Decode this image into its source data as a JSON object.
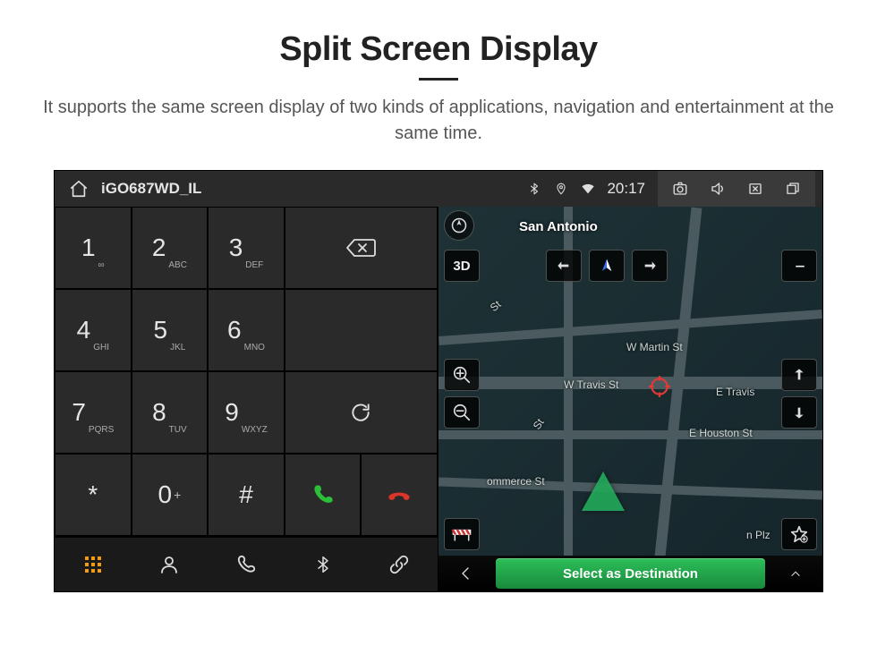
{
  "marketing": {
    "title": "Split Screen Display",
    "subtitle": "It supports the same screen display of two kinds of applications, navigation and entertainment at the same time."
  },
  "statusbar": {
    "app_title": "iGO687WD_IL",
    "time": "20:17",
    "icons": {
      "home": "home-icon",
      "bluetooth": "bluetooth-icon",
      "location": "location-pin-icon",
      "wifi": "wifi-icon",
      "camera": "camera-icon",
      "volume": "volume-icon",
      "close": "close-app-icon",
      "recent": "recent-apps-icon"
    }
  },
  "dialer": {
    "keys": [
      {
        "num": "1",
        "letters": "∞"
      },
      {
        "num": "2",
        "letters": "ABC"
      },
      {
        "num": "3",
        "letters": "DEF"
      },
      {
        "num": "4",
        "letters": "GHI"
      },
      {
        "num": "5",
        "letters": "JKL"
      },
      {
        "num": "6",
        "letters": "MNO"
      },
      {
        "num": "7",
        "letters": "PQRS"
      },
      {
        "num": "8",
        "letters": "TUV"
      },
      {
        "num": "9",
        "letters": "WXYZ"
      },
      {
        "num": "*",
        "letters": ""
      },
      {
        "num": "0",
        "letters": "",
        "plus": "+"
      },
      {
        "num": "#",
        "letters": ""
      }
    ],
    "actions": {
      "backspace": "backspace-icon",
      "refresh": "refresh-icon",
      "call": "call-icon",
      "end": "end-call-icon"
    },
    "tabs": {
      "grid": "dial-grid-icon",
      "contacts": "person-icon",
      "recent": "phone-icon",
      "bluetooth": "bluetooth-icon",
      "link": "link-icon"
    }
  },
  "map": {
    "city": "San Antonio",
    "streets": {
      "martin": "W Martin St",
      "travis": "W Travis St",
      "houston": "E Houston St",
      "travis_e": "E Travis",
      "commerce": "ommerce St",
      "plz": "n Plz",
      "st1": "St",
      "st2": "St"
    },
    "controls": {
      "threeD": "3D",
      "dashes": "--",
      "compass": "compass-icon",
      "back": "arrow-left-icon",
      "north": "north-arrow-icon",
      "forward": "arrow-right-icon",
      "zoom_in": "zoom-in-icon",
      "zoom_out": "zoom-out-icon",
      "up": "arrow-up-icon",
      "down": "arrow-down-icon",
      "barrier": "road-barrier-icon",
      "star": "star-favorite-icon"
    },
    "bottom": {
      "back": "chevron-left-icon",
      "destination": "Select as Destination",
      "more": "chevron-up-icon"
    }
  }
}
